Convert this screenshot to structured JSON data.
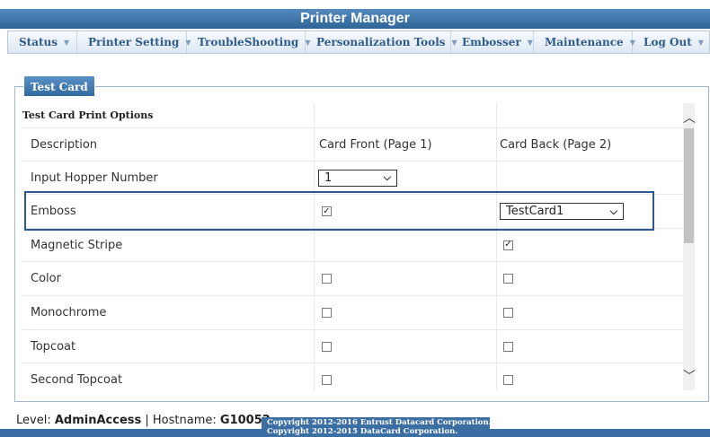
{
  "app": {
    "title": "Printer Manager"
  },
  "nav": [
    {
      "label": "Status"
    },
    {
      "label": "Printer Setting"
    },
    {
      "label": "TroubleShooting"
    },
    {
      "label": "Personalization Tools"
    },
    {
      "label": "Embosser"
    },
    {
      "label": "Maintenance"
    },
    {
      "label": "Log Out"
    }
  ],
  "tab": {
    "label": "Test Card"
  },
  "table": {
    "section_title": "Test Card Print Options",
    "headers": {
      "description": "Description",
      "front": "Card Front (Page 1)",
      "back": "Card Back (Page 2)"
    },
    "rows": [
      {
        "label": "Input Hopper Number",
        "front_select": "1"
      },
      {
        "label": "Emboss",
        "front_checked": true,
        "back_select": "TestCard1"
      },
      {
        "label": "Magnetic Stripe",
        "back_checked": true
      },
      {
        "label": "Color",
        "front_checked": false,
        "back_checked": false
      },
      {
        "label": "Monochrome",
        "front_checked": false,
        "back_checked": false
      },
      {
        "label": "Topcoat",
        "front_checked": false,
        "back_checked": false
      },
      {
        "label": "Second Topcoat",
        "front_checked": false,
        "back_checked": false
      }
    ]
  },
  "checkmark": "✓",
  "status": {
    "level_label": "Level:",
    "level_value": "AdminAccess",
    "separator": "|",
    "hostname_label": "Hostname:",
    "hostname_value": "G10052"
  },
  "copyright": [
    "Copyright 2012-2016 Entrust Datacard Corporation.",
    "Copyright 2012-2015 DataCard Corporation."
  ],
  "colors": {
    "header_blue": "#2f6497",
    "nav_text": "#2e5c8c",
    "highlight": "#2d5a8e"
  }
}
